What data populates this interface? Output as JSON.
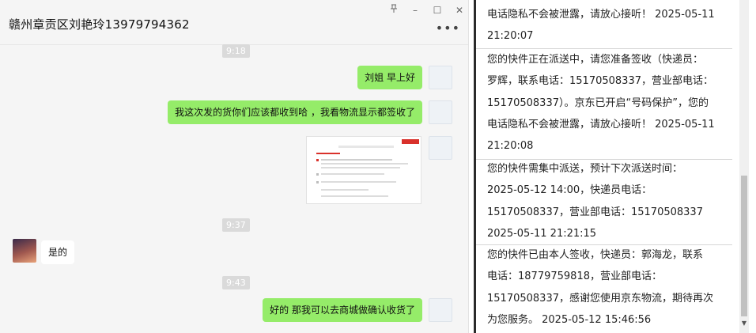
{
  "chat": {
    "title": "赣州章贡区刘艳玲13979794362",
    "window_controls": {
      "pin": "푸",
      "minimize": "–",
      "maximize": "☐",
      "close": "✕"
    },
    "more": "•••",
    "messages": [
      {
        "type": "time",
        "text": "9:18"
      },
      {
        "type": "text",
        "side": "right",
        "text": "刘姐  早上好"
      },
      {
        "type": "text",
        "side": "right",
        "text": "我这次发的货你们应该都收到哈 ，我看物流显示都签收了"
      },
      {
        "type": "image",
        "side": "right",
        "description": "screenshot"
      },
      {
        "type": "time",
        "text": "9:37"
      },
      {
        "type": "text",
        "side": "left",
        "text": "是的"
      },
      {
        "type": "time",
        "text": "9:43"
      },
      {
        "type": "text",
        "side": "right",
        "text": "好的 那我可以去商城做确认收货了"
      }
    ]
  },
  "panel": {
    "notes": [
      {
        "lines": [
          "电话隐私不会被泄露，请放心接听！ 2025-05-11",
          "21:20:07"
        ]
      },
      {
        "lines": [
          "您的快件正在派送中，请您准备签收（快递员：",
          "罗辉，联系电话：15170508337，营业部电话：",
          "15170508337）。京东已开启“号码保护”，您的",
          "电话隐私不会被泄露，请放心接听！ 2025-05-11",
          "21:20:08"
        ]
      },
      {
        "lines": [
          "您的快件需集中派送，预计下次派送时间：",
          "2025-05-12 14:00，快递员电话：",
          "15170508337，营业部电话：15170508337",
          "2025-05-11 21:21:15"
        ]
      },
      {
        "lines": [
          "您的快件已由本人签收，快递员：郭海龙，联系",
          "电话：18779759818，营业部电话：",
          "15170508337，感谢您使用京东物流，期待再次",
          "为您服务。 2025-05-12 15:46:56"
        ]
      }
    ]
  },
  "colors": {
    "bubble_green": "#95ec69",
    "chat_bg": "#f5f5f5",
    "panel_bg": "#ffffff"
  }
}
